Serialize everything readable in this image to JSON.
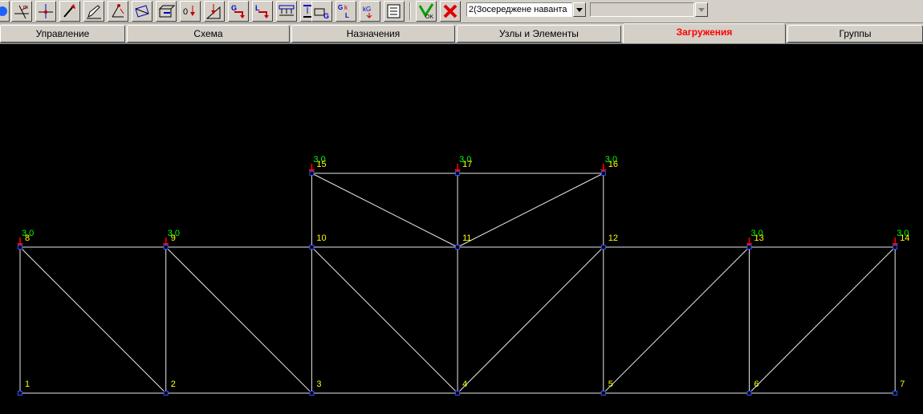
{
  "toolbar": {
    "load_case_select": "2(Зосереджене наванта",
    "second_select": "",
    "icons": [
      "node-tool-icon",
      "cut-icon",
      "axis-icon",
      "pencil-icon",
      "eraser-icon",
      "plane-icon",
      "box-icon",
      "zero-load-icon",
      "triangle-load-icon",
      "global-load-icon",
      "g-arrow-icon",
      "l-arrow-icon",
      "distributed-load-icon",
      "arrow-down-load-icon",
      "g-frame-icon",
      "g-k-l-icon",
      "kg-icon",
      "list-icon",
      "accept-icon",
      "cancel-icon"
    ],
    "text_marks": {
      "g": "G",
      "l": "L",
      "k": "k",
      "kg": "kG",
      "ok": "OK"
    }
  },
  "tabs": [
    {
      "label": "Управление"
    },
    {
      "label": "Схема"
    },
    {
      "label": "Назначения"
    },
    {
      "label": "Узлы и Элементы"
    },
    {
      "label": "Загружения",
      "active": true
    },
    {
      "label": "Группы"
    }
  ],
  "scene": {
    "colors": {
      "bar": "#e8e8e8",
      "node": "#3050ff",
      "node_label": "#ffff00",
      "load_label": "#00ff00",
      "load_arrow": "#ff0000"
    },
    "nodes": [
      {
        "id": "1",
        "col": 0,
        "row": 0
      },
      {
        "id": "2",
        "col": 1,
        "row": 0
      },
      {
        "id": "3",
        "col": 2,
        "row": 0
      },
      {
        "id": "4",
        "col": 3,
        "row": 0
      },
      {
        "id": "5",
        "col": 4,
        "row": 0
      },
      {
        "id": "6",
        "col": 5,
        "row": 0
      },
      {
        "id": "7",
        "col": 6,
        "row": 0
      },
      {
        "id": "8",
        "col": 0,
        "row": 1
      },
      {
        "id": "9",
        "col": 1,
        "row": 1
      },
      {
        "id": "10",
        "col": 2,
        "row": 1
      },
      {
        "id": "11",
        "col": 3,
        "row": 1
      },
      {
        "id": "12",
        "col": 4,
        "row": 1
      },
      {
        "id": "13",
        "col": 5,
        "row": 1
      },
      {
        "id": "14",
        "col": 6,
        "row": 1
      },
      {
        "id": "15",
        "col": 2,
        "row": 2
      },
      {
        "id": "17",
        "col": 3,
        "row": 2
      },
      {
        "id": "16",
        "col": 4,
        "row": 2
      }
    ],
    "bars": [
      [
        "1",
        "2"
      ],
      [
        "2",
        "3"
      ],
      [
        "3",
        "4"
      ],
      [
        "4",
        "5"
      ],
      [
        "5",
        "6"
      ],
      [
        "6",
        "7"
      ],
      [
        "8",
        "9"
      ],
      [
        "9",
        "10"
      ],
      [
        "10",
        "11"
      ],
      [
        "11",
        "12"
      ],
      [
        "12",
        "13"
      ],
      [
        "13",
        "14"
      ],
      [
        "15",
        "17"
      ],
      [
        "17",
        "16"
      ],
      [
        "1",
        "8"
      ],
      [
        "2",
        "9"
      ],
      [
        "3",
        "10"
      ],
      [
        "4",
        "11"
      ],
      [
        "5",
        "12"
      ],
      [
        "6",
        "13"
      ],
      [
        "7",
        "14"
      ],
      [
        "10",
        "15"
      ],
      [
        "11",
        "17"
      ],
      [
        "12",
        "16"
      ],
      [
        "8",
        "2"
      ],
      [
        "9",
        "3"
      ],
      [
        "10",
        "4"
      ],
      [
        "4",
        "12"
      ],
      [
        "5",
        "13"
      ],
      [
        "6",
        "14"
      ],
      [
        "15",
        "11"
      ],
      [
        "11",
        "16"
      ]
    ],
    "loads": [
      {
        "node": "8",
        "value": "3,0"
      },
      {
        "node": "9",
        "value": "3,0"
      },
      {
        "node": "13",
        "value": "3,0"
      },
      {
        "node": "14",
        "value": "3,0"
      },
      {
        "node": "15",
        "value": "3,0"
      },
      {
        "node": "17",
        "value": "3,0"
      },
      {
        "node": "16",
        "value": "3,0"
      }
    ]
  }
}
